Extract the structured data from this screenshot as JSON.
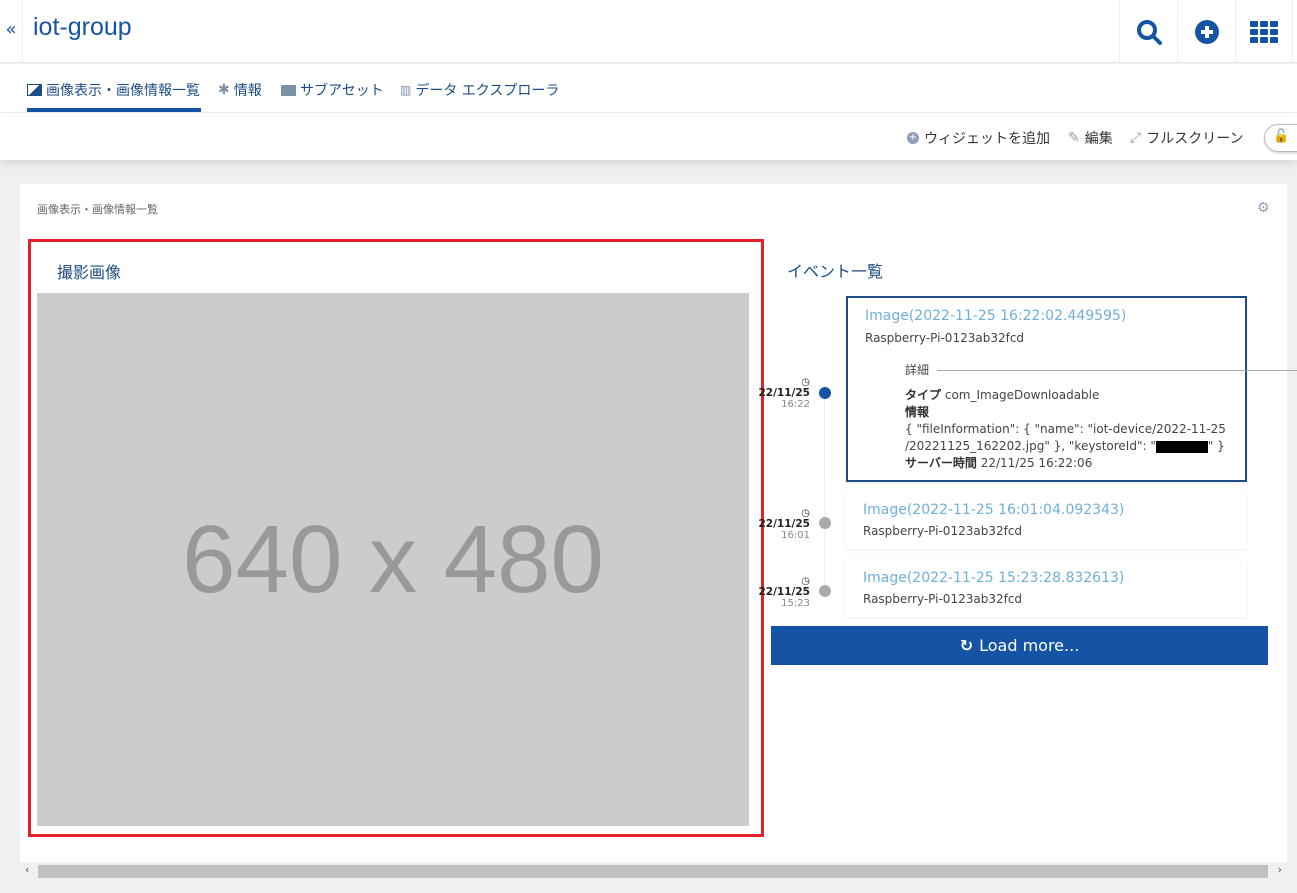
{
  "header": {
    "back": "«",
    "title": "iot-group"
  },
  "tabs": [
    {
      "label": "画像表示・画像情報一覧"
    },
    {
      "label": "情報"
    },
    {
      "label": "サブアセット"
    },
    {
      "label": "データ エクスプローラ"
    }
  ],
  "toolbar": {
    "add_widget": "ウィジェットを追加",
    "edit": "編集",
    "fullscreen": "フルスクリーン"
  },
  "card": {
    "title": "画像表示・画像情報一覧"
  },
  "image_panel": {
    "title": "撮影画像",
    "placeholder": "640 x 480"
  },
  "events": {
    "title": "イベント一覧",
    "load_more": "Load more...",
    "details_label": "詳細",
    "type_label": "タイプ",
    "info_label": "情報",
    "server_time_label": "サーバー時間",
    "items": [
      {
        "date": "22/11/25",
        "time": "16:22",
        "title": "Image(2022-11-25 16:22:02.449595)",
        "source": "Raspberry-Pi-0123ab32fcd",
        "type": "com_ImageDownloadable",
        "info_line1": "{ \"fileInformation\": { \"name\": \"iot-device/2022-11-25",
        "info_line2a": "/20221125_162202.jpg\" }, \"keystoreId\": \"",
        "info_line2b": "\" }",
        "server_time": "22/11/25 16:22:06"
      },
      {
        "date": "22/11/25",
        "time": "16:01",
        "title": "Image(2022-11-25 16:01:04.092343)",
        "source": "Raspberry-Pi-0123ab32fcd"
      },
      {
        "date": "22/11/25",
        "time": "15:23",
        "title": "Image(2022-11-25 15:23:28.832613)",
        "source": "Raspberry-Pi-0123ab32fcd"
      }
    ]
  },
  "colors": {
    "brand": "#1554a5",
    "highlight": "#e3202a"
  }
}
